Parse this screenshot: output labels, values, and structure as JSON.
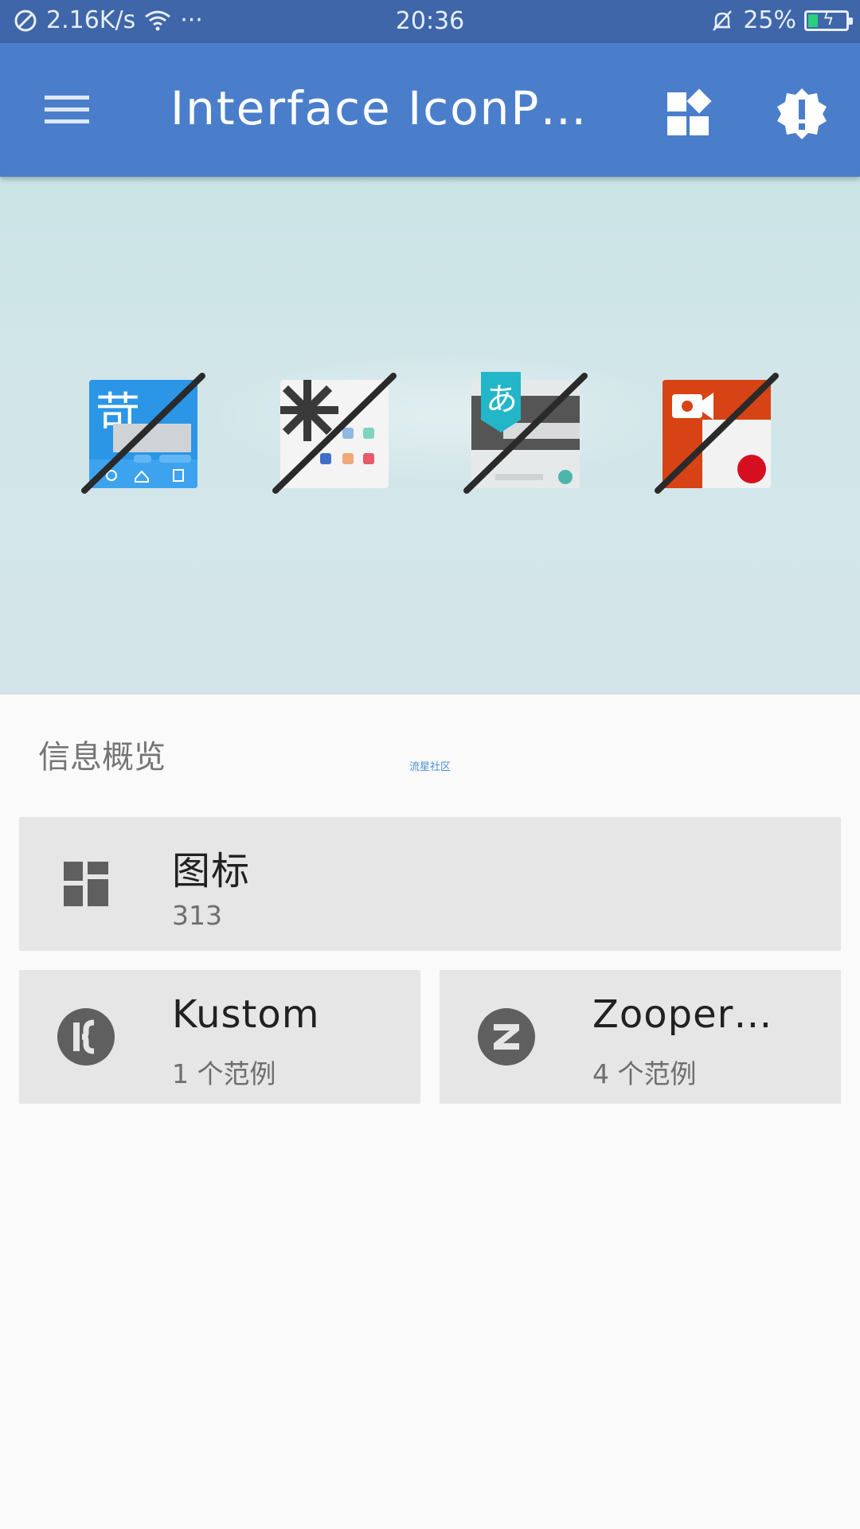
{
  "status_bar": {
    "speed": "2.16K/s",
    "more": "···",
    "time": "20:36",
    "battery": "25%"
  },
  "toolbar": {
    "title": "Interface IconP…",
    "menu_icon": "hamburger-menu-icon",
    "dashboard_icon": "dashboard-icon",
    "alert_icon": "badge-alert-icon"
  },
  "hero": {
    "icons": [
      "gosms-icon",
      "launcher-icon",
      "google-japanese-input-icon",
      "screen-recorder-icon"
    ],
    "icon_glyphs": {
      "gosms": "苛",
      "japanese": "あ"
    }
  },
  "overview": {
    "title": "信息概览",
    "watermark": "流星社区",
    "cards": [
      {
        "name": "图标",
        "sub": "313",
        "icon": "dashboard-icon"
      },
      {
        "name": "Kustom",
        "sub": "1 个范例",
        "icon": "kustom-icon"
      },
      {
        "name": "Zooper…",
        "sub": "4 个范例",
        "icon": "zooper-icon"
      }
    ]
  }
}
